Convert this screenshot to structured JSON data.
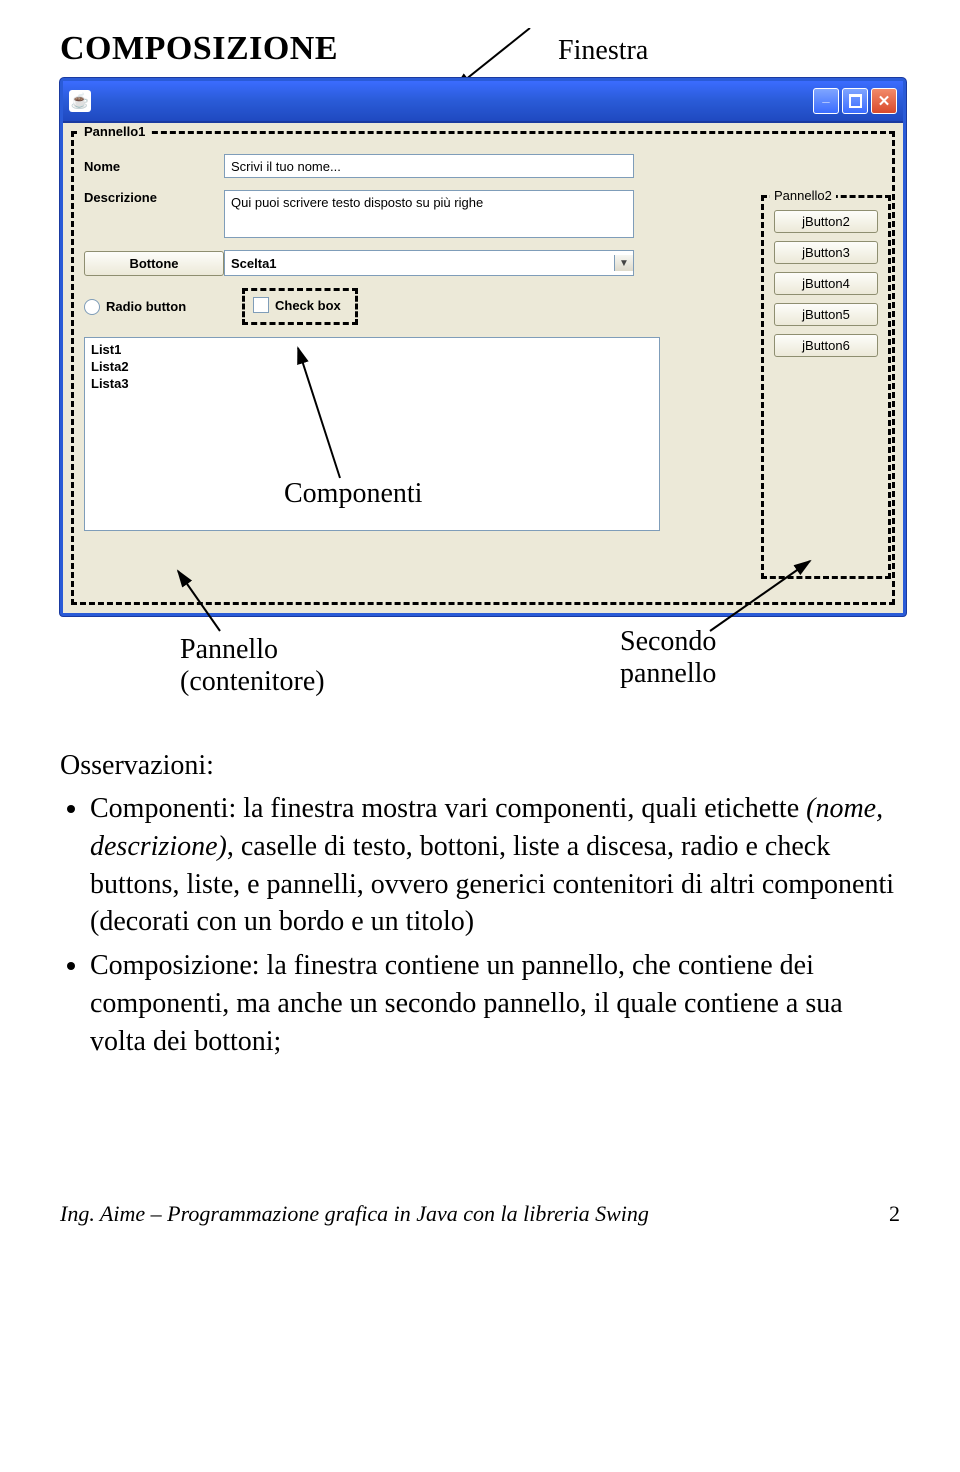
{
  "heading": "COMPOSIZIONE",
  "annotations": {
    "finestra": "Finestra",
    "componenti": "Componenti",
    "pannello": "Pannello\n(contenitore)",
    "secondo": "Secondo\npannello"
  },
  "window": {
    "logo_glyph": "☕",
    "minimize_glyph": "_",
    "close_glyph": "✕"
  },
  "panel1": {
    "title": "Pannello1",
    "nome_label": "Nome",
    "nome_value": "Scrivi il tuo nome...",
    "descr_label": "Descrizione",
    "descr_value": "Qui puoi scrivere testo disposto su più righe",
    "button_label": "Bottone",
    "combo_value": "Scelta1",
    "radio_label": "Radio button",
    "checkbox_label": "Check box",
    "list_items": [
      "List1",
      "Lista2",
      "Lista3"
    ]
  },
  "panel2": {
    "title": "Pannello2",
    "buttons": [
      "jButton2",
      "jButton3",
      "jButton4",
      "jButton5",
      "jButton6"
    ]
  },
  "observations": {
    "heading": "Osservazioni:",
    "item1_a": "Componenti: la finestra mostra vari componenti, quali etichette ",
    "item1_i": "(nome, descrizione)",
    "item1_b": ", caselle di testo, bottoni, liste a discesa, radio e check buttons, liste, e pannelli, ovvero generici contenitori di altri componenti (decorati con un bordo e un titolo)",
    "item2": "Composizione: la finestra contiene un pannello, che contiene dei componenti, ma anche un secondo pannello, il quale contiene a sua volta dei bottoni;"
  },
  "footer": {
    "left": "Ing. Aime – Programmazione grafica in Java con la libreria Swing",
    "page": "2"
  }
}
